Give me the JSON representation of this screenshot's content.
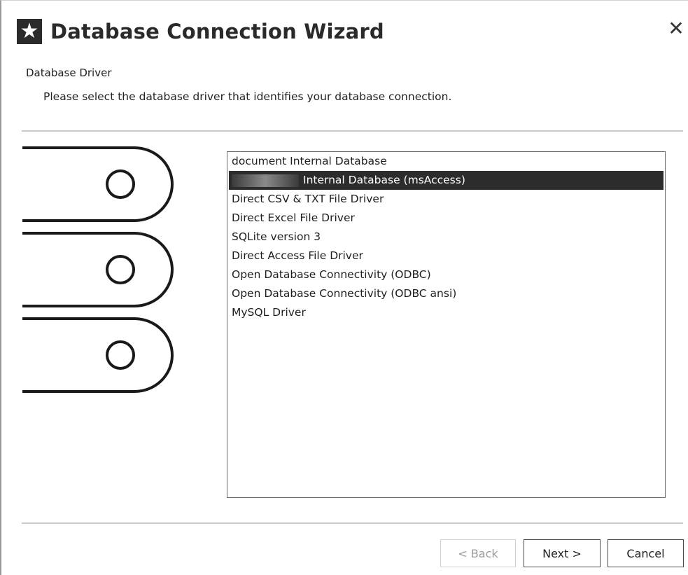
{
  "window": {
    "title": "Database Connection Wizard",
    "app_icon": "star-icon",
    "close_icon": "close-icon",
    "close_glyph": "✕"
  },
  "section": {
    "title": "Database Driver",
    "description": "Please select the database driver that identifies your database connection."
  },
  "illustration": {
    "name": "database-stack-illustration"
  },
  "drivers": {
    "selected_index": 1,
    "items": [
      {
        "label": "document Internal Database",
        "redacted_prefix": false
      },
      {
        "label": "Internal Database (msAccess)",
        "redacted_prefix": true
      },
      {
        "label": "Direct CSV & TXT File Driver",
        "redacted_prefix": false
      },
      {
        "label": "Direct Excel File Driver",
        "redacted_prefix": false
      },
      {
        "label": "SQLite version 3",
        "redacted_prefix": false
      },
      {
        "label": "Direct Access File Driver",
        "redacted_prefix": false
      },
      {
        "label": "Open Database Connectivity (ODBC)",
        "redacted_prefix": false
      },
      {
        "label": "Open Database Connectivity (ODBC ansi)",
        "redacted_prefix": false
      },
      {
        "label": "MySQL Driver",
        "redacted_prefix": false
      }
    ]
  },
  "buttons": {
    "back": "< Back",
    "next": "Next >",
    "cancel": "Cancel",
    "back_enabled": false
  },
  "colors": {
    "selection_bg": "#2c2c2c",
    "selection_fg": "#ffffff",
    "divider": "#c8c8c8"
  }
}
